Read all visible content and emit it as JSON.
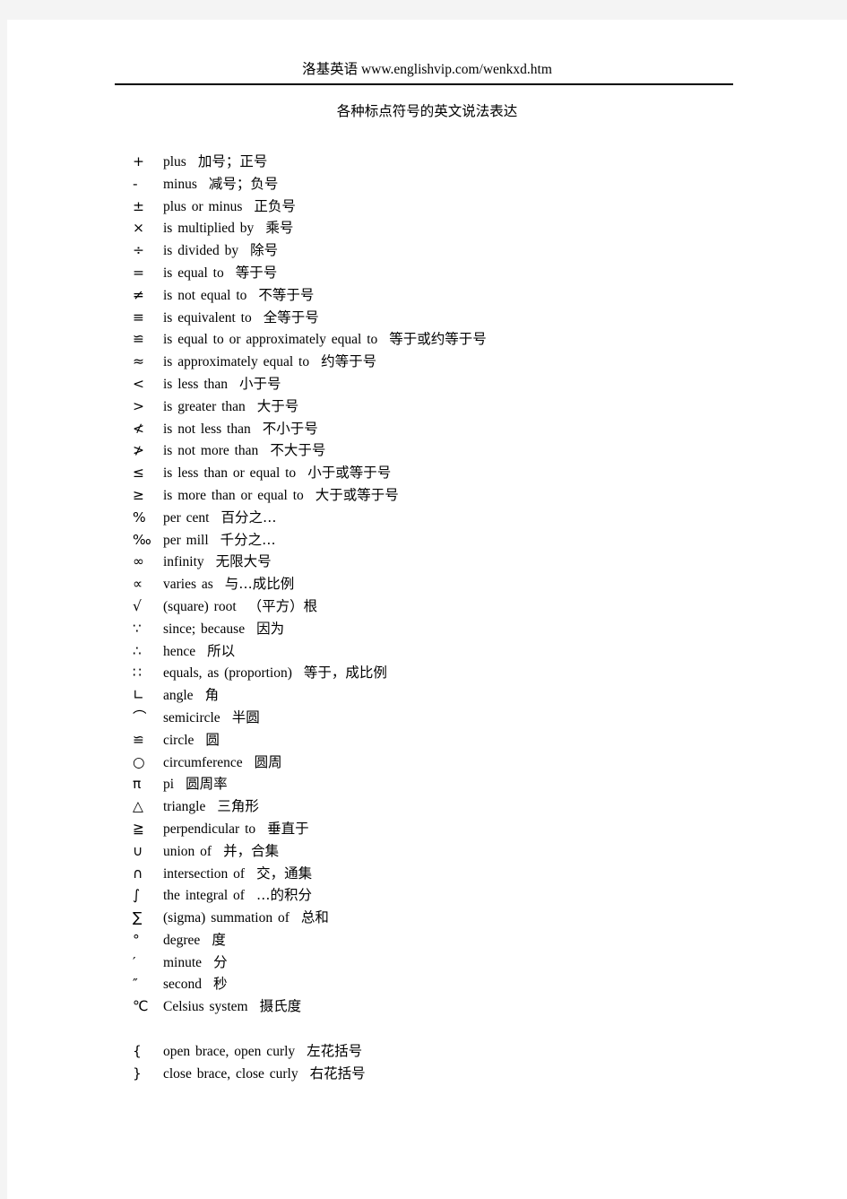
{
  "header": {
    "text": "洛基英语 www.englishvip.com/wenkxd.htm"
  },
  "title": "各种标点符号的英文说法表达",
  "symbols": [
    {
      "glyph": "+",
      "english": "plus",
      "chinese": "加号；正号"
    },
    {
      "glyph": "-",
      "english": "minus",
      "chinese": "减号；负号"
    },
    {
      "glyph": "±",
      "english": "plus or minus",
      "chinese": "正负号"
    },
    {
      "glyph": "×",
      "english": "is multiplied by",
      "chinese": "乘号"
    },
    {
      "glyph": "÷",
      "english": "is divided by",
      "chinese": "除号"
    },
    {
      "glyph": "=",
      "english": "is equal to",
      "chinese": "等于号"
    },
    {
      "glyph": "≠",
      "english": "is not equal to",
      "chinese": "不等于号"
    },
    {
      "glyph": "≡",
      "english": "is equivalent to",
      "chinese": "全等于号"
    },
    {
      "glyph": "≌",
      "english": "is equal to or approximately equal to",
      "chinese": "等于或约等于号"
    },
    {
      "glyph": "≈",
      "english": "is approximately equal to",
      "chinese": "约等于号"
    },
    {
      "glyph": "<",
      "english": "is less than",
      "chinese": "小于号"
    },
    {
      "glyph": ">",
      "english": "is greater than",
      "chinese": "大于号"
    },
    {
      "glyph": "≮",
      "english": "is not less than",
      "chinese": "不小于号"
    },
    {
      "glyph": "≯",
      "english": "is not more than",
      "chinese": "不大于号"
    },
    {
      "glyph": "≤",
      "english": "is less than or equal to",
      "chinese": "小于或等于号"
    },
    {
      "glyph": "≥",
      "english": "is more than or equal to",
      "chinese": "大于或等于号"
    },
    {
      "glyph": "%",
      "english": " per cent",
      "chinese": "百分之…"
    },
    {
      "glyph": "‰",
      "english": "per mill",
      "chinese": "千分之…"
    },
    {
      "glyph": "∞",
      "english": "infinity",
      "chinese": "无限大号"
    },
    {
      "glyph": "∝",
      "english": "varies as",
      "chinese": "与…成比例"
    },
    {
      "glyph": "√",
      "english": "(square) root",
      "chinese": "（平方）根"
    },
    {
      "glyph": "∵",
      "english": "since; because",
      "chinese": "因为"
    },
    {
      "glyph": "∴",
      "english": "hence",
      "chinese": "所以"
    },
    {
      "glyph": "∷",
      "english": "equals, as (proportion)",
      "chinese": "等于，成比例"
    },
    {
      "glyph": "∟",
      "english": "angle",
      "chinese": "角"
    },
    {
      "glyph": "⌒",
      "english": "semicircle",
      "chinese": "半圆"
    },
    {
      "glyph": "≌",
      "english": "circle",
      "chinese": "圆"
    },
    {
      "glyph": "○",
      "english": "circumference",
      "chinese": "圆周"
    },
    {
      "glyph": "π",
      "english": "pi",
      "chinese": "圆周率"
    },
    {
      "glyph": "△",
      "english": "triangle",
      "chinese": "三角形"
    },
    {
      "glyph": "≧",
      "english": "perpendicular to",
      "chinese": "垂直于"
    },
    {
      "glyph": "∪",
      "english": "union of",
      "chinese": "并，合集"
    },
    {
      "glyph": "∩",
      "english": "intersection of",
      "chinese": "交，通集"
    },
    {
      "glyph": "∫",
      "english": "the integral of",
      "chinese": "…的积分"
    },
    {
      "glyph": "∑",
      "english": "(sigma) summation of",
      "chinese": "总和"
    },
    {
      "glyph": "°",
      "english": "degree",
      "chinese": "度"
    },
    {
      "glyph": "′",
      "english": "minute",
      "chinese": "分"
    },
    {
      "glyph": "″",
      "english": "second",
      "chinese": "秒"
    },
    {
      "glyph": "℃",
      "english": "Celsius system",
      "chinese": "摄氏度"
    },
    {
      "glyph": "",
      "english": "",
      "chinese": "",
      "spacer": true
    },
    {
      "glyph": "{",
      "english": "open brace, open curly",
      "chinese": "左花括号"
    },
    {
      "glyph": "}",
      "english": "close brace, close curly",
      "chinese": "右花括号"
    }
  ]
}
